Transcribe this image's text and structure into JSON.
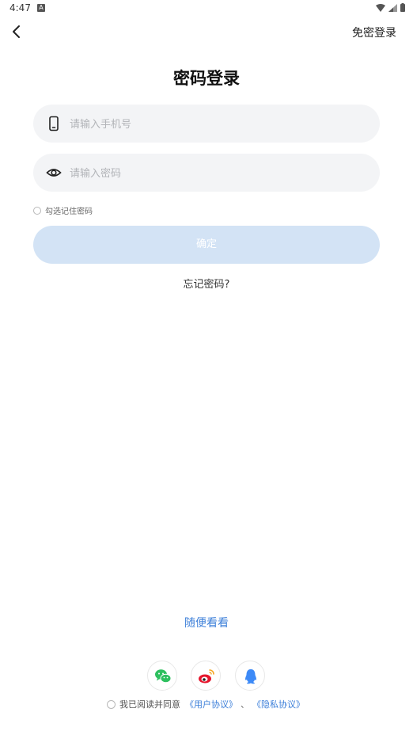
{
  "status": {
    "time": "4:47",
    "notif_icon": "A"
  },
  "topbar": {
    "back_icon": "chevron-left-icon",
    "alt_login": "免密登录"
  },
  "title": "密码登录",
  "phone": {
    "placeholder": "请输入手机号",
    "value": ""
  },
  "password": {
    "placeholder": "请输入密码",
    "value": ""
  },
  "remember": {
    "label": "勾选记住密码",
    "checked": false
  },
  "confirm": {
    "label": "确定",
    "enabled": false
  },
  "forgot": "忘记密码?",
  "browse": "随便看看",
  "social": [
    {
      "name": "wechat-icon",
      "color": "#2ec05f"
    },
    {
      "name": "weibo-icon",
      "color": "#e6162d"
    },
    {
      "name": "qq-icon",
      "color": "#3d8af7"
    }
  ],
  "agreement": {
    "checked": false,
    "text": "我已阅读并同意",
    "user_agreement": "《用户协议》",
    "separator": "、",
    "privacy_policy": "《隐私协议》"
  },
  "colors": {
    "accent": "#3c7fd9",
    "button_disabled": "#d3e3f5",
    "field_bg": "#f3f4f6"
  }
}
